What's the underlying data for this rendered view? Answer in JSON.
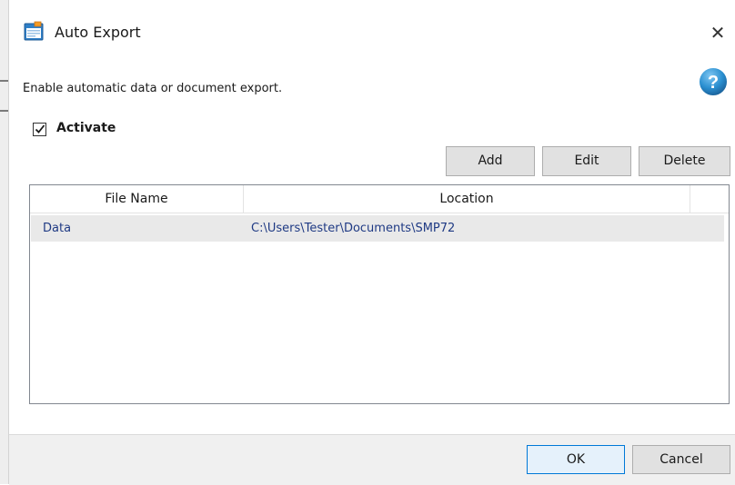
{
  "window": {
    "title": "Auto Export",
    "icon": "auto-export-app-icon",
    "close_glyph": "✕"
  },
  "description": "Enable automatic data or document export.",
  "help": {
    "icon": "help-question-icon",
    "glyph": "?"
  },
  "activate": {
    "label": "Activate",
    "checked": true
  },
  "toolbar": {
    "add_label": "Add",
    "edit_label": "Edit",
    "delete_label": "Delete"
  },
  "table": {
    "columns": [
      "File Name",
      "Location"
    ],
    "rows": [
      {
        "file_name": "Data",
        "location": "C:\\Users\\Tester\\Documents\\SMP72"
      }
    ]
  },
  "footer": {
    "ok_label": "OK",
    "cancel_label": "Cancel"
  },
  "colors": {
    "accent": "#0078d7",
    "link_text": "#1f3a84",
    "selected_row": "#e9e9e9",
    "help_blue": "#2a8fd0"
  }
}
